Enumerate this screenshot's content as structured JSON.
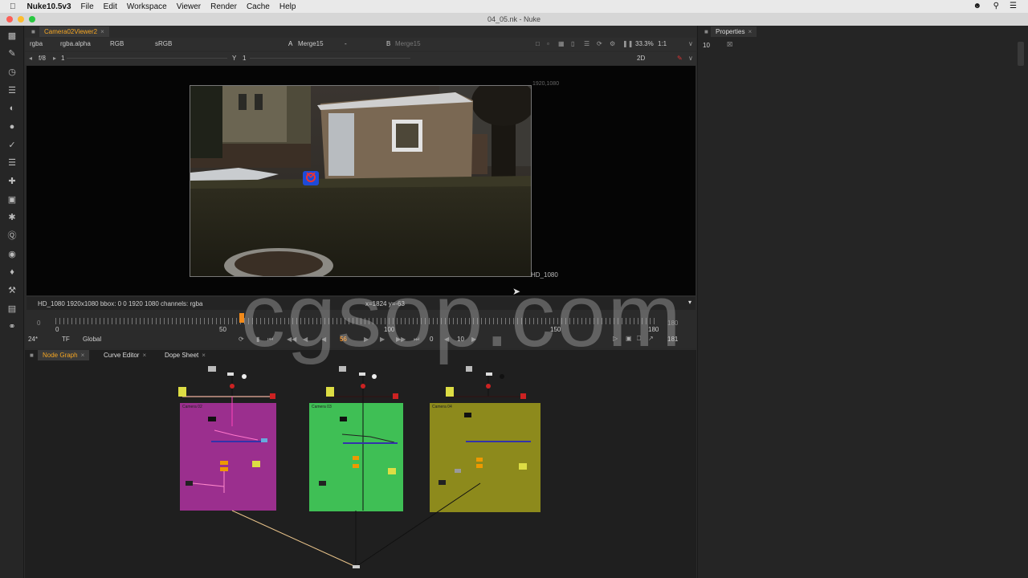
{
  "menubar": {
    "app_name": "Nuke10.5v3",
    "items": [
      "File",
      "Edit",
      "Workspace",
      "Viewer",
      "Render",
      "Cache",
      "Help"
    ]
  },
  "window": {
    "title": "04_05.nk - Nuke"
  },
  "viewer": {
    "tab": "Camera02Viewer2",
    "channels": "rgba",
    "alpha": "rgba.alpha",
    "display": "RGB",
    "lut": "sRGB",
    "a_input_label": "A",
    "a_input": "Merge15",
    "a_dash": "-",
    "b_input_label": "B",
    "b_input": "Merge15",
    "zoom": "33.3%",
    "ratio": "1:1",
    "mode": "2D",
    "fstop": "f/8",
    "gain": "1",
    "gamma_label": "Y",
    "gamma": "1",
    "format_top": "1920,1080",
    "format_bottom": "HD_1080",
    "info_left": "HD_1080 1920x1080  bbox: 0 0 1920 1080 channels: rgba",
    "info_coords": "x=1824 y=-63"
  },
  "timeline": {
    "start": "0",
    "end": "180",
    "ticks": [
      "0",
      "50",
      "100",
      "150",
      "180"
    ],
    "current_frame": "56",
    "fps": "24*",
    "tf": "TF",
    "scope": "Global",
    "frame_field": "0",
    "step": "10",
    "end_field": "181",
    "marker_label": "56"
  },
  "nodegraph": {
    "tabs": [
      "Node Graph",
      "Curve Editor",
      "Dope Sheet"
    ],
    "backdrops": [
      {
        "label": "Camera 02",
        "color": "#9b2f8e"
      },
      {
        "label": "Camera 03",
        "color": "#3fbf55"
      },
      {
        "label": "Camera 04",
        "color": "#8d8a1c"
      }
    ]
  },
  "properties": {
    "tab": "Properties",
    "count": "10"
  },
  "watermark": "cgsop.com"
}
